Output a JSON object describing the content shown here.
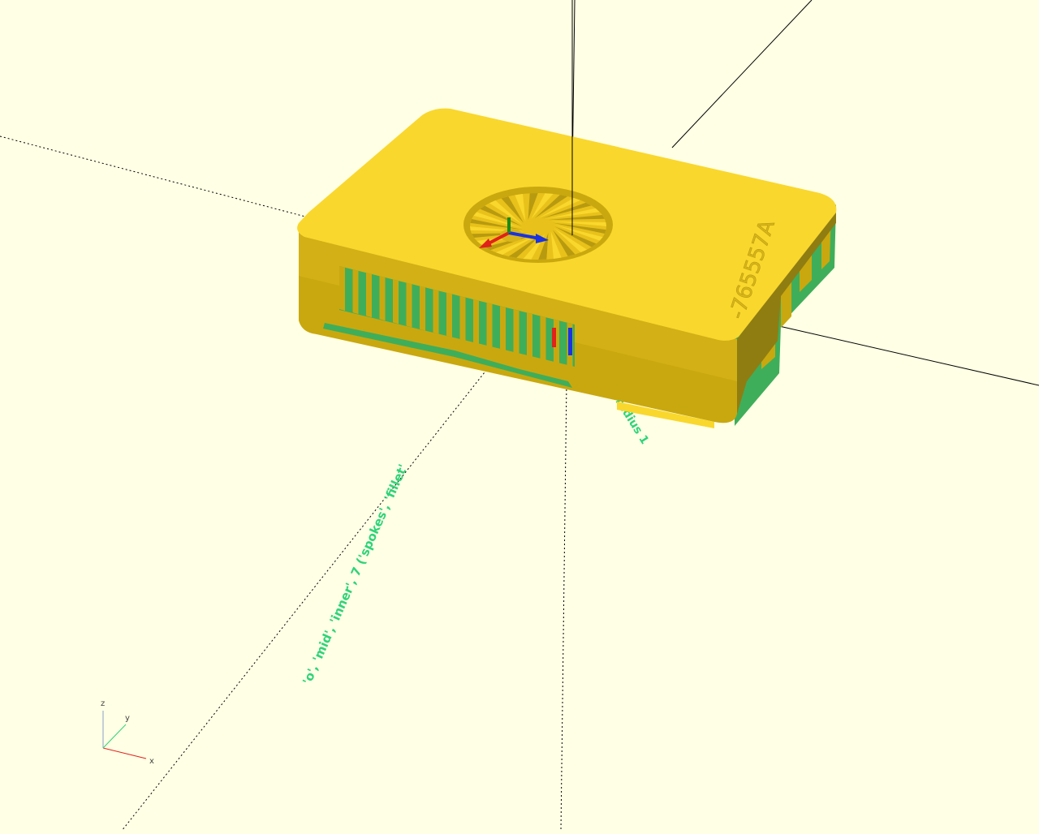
{
  "viewport": {
    "background": "#ffffe5",
    "model_color": "#f9d72c",
    "model_shadow": "#c9a80f",
    "model_dark": "#8f7d12",
    "annotation_color": "#2fd37a"
  },
  "model": {
    "engraved_label": "-765557A"
  },
  "annotations": {
    "long_text": "'o', 'mid', 'inner', 7 ('spokes', 'fillet'",
    "short_text": "radius 1"
  },
  "axis_gizmo": {
    "x_label": "x",
    "y_label": "y",
    "z_label": "z"
  }
}
